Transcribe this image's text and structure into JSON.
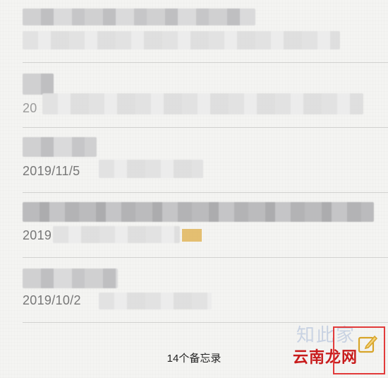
{
  "notes": [
    {
      "title": "",
      "date": ""
    },
    {
      "title": "",
      "date": "20"
    },
    {
      "title": "",
      "date": "2019/11/5"
    },
    {
      "title": "",
      "date": "2019"
    },
    {
      "title": "",
      "date": "2019/10/2"
    }
  ],
  "footer": {
    "count_label": "14个备忘录",
    "watermark_text": "云南龙网",
    "watermark_faint": "知此家"
  },
  "icons": {
    "compose": "compose-icon"
  },
  "colors": {
    "highlight_box": "#e23a3a",
    "watermark": "#c81c1c"
  }
}
